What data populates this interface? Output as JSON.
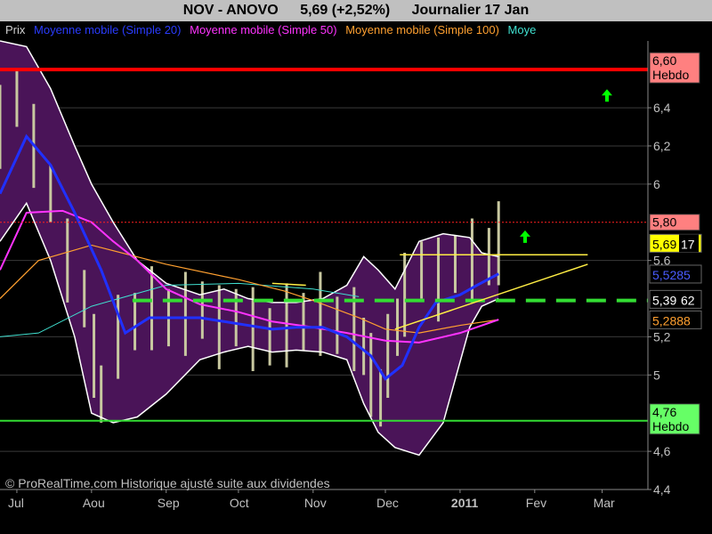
{
  "header": {
    "symbol": "NOV - ANOVO",
    "quote": "5,69 (+2,52%)",
    "period": "Journalier  17 Jan"
  },
  "legend": [
    {
      "label": "Prix",
      "color": "#d0d0d0"
    },
    {
      "label": "Moyenne mobile (Simple 20)",
      "color": "#2a3cff"
    },
    {
      "label": "Moyenne mobile (Simple 50)",
      "color": "#ff33ff"
    },
    {
      "label": "Moyenne mobile (Simple 100)",
      "color": "#ffa030"
    },
    {
      "label": "Moye",
      "color": "#40e0d0"
    }
  ],
  "credit": "© ProRealTime.com Historique ajusté suite aux dividendes",
  "colors": {
    "band_fill": "#4a1458",
    "band_edge": "#ffffff",
    "candles": "#c8c8a0",
    "ma20": "#2030ff",
    "ma50": "#ff33ff",
    "ma100": "#ffa030",
    "ma200": "#40e0d0",
    "resistance": "#ff0000",
    "support": "#33dd33",
    "dashed_level": "#33dd33",
    "trend": "#ffee44",
    "arrow": "#00ff00"
  },
  "chart_data": {
    "type": "line",
    "title": "NOV - ANOVO",
    "ylim": [
      4.4,
      6.75
    ],
    "y_ticks": [
      "6,4",
      "6,2",
      "6",
      "5,6",
      "5,2",
      "5",
      "4,6",
      "4,4"
    ],
    "y_tick_values": [
      6.4,
      6.2,
      6.0,
      5.6,
      5.2,
      5.0,
      4.6,
      4.4
    ],
    "x_ticks": [
      "Jul",
      "Aou",
      "Sep",
      "Oct",
      "Nov",
      "Dec",
      "2011",
      "Fev",
      "Mar"
    ],
    "x_tick_dates": [
      "2010-07-01",
      "2010-08-01",
      "2010-09-01",
      "2010-10-01",
      "2010-11-01",
      "2010-12-01",
      "2011-01-01",
      "2011-02-01",
      "2011-03-01"
    ],
    "x_range": [
      "2010-06-24",
      "2011-03-20"
    ],
    "last_date": "2011-01-17",
    "levels": [
      {
        "name": "resistance_hebdo",
        "label_value": "6,60",
        "label_text": "Hebdo",
        "value": 6.6,
        "color": "#ff0000",
        "badge_bg": "#ff8080",
        "style": "solid"
      },
      {
        "name": "level_580",
        "label_value": "5,80",
        "value": 5.8,
        "color": "#ff2020",
        "badge_bg": "#ff8080",
        "style": "dotted"
      },
      {
        "name": "support_dashed",
        "value": 5.39,
        "color": "#33dd33",
        "style": "dashed",
        "from": "2010-08-18"
      },
      {
        "name": "support_hebdo",
        "label_value": "4,76",
        "label_text": "Hebdo",
        "value": 4.76,
        "color": "#33dd33",
        "badge_bg": "#66ff66",
        "style": "solid"
      }
    ],
    "price_badges": [
      {
        "text": "5,69",
        "suffix": "17",
        "value": 5.69,
        "bg": "#ffff00",
        "fg": "#000"
      },
      {
        "text": "5,5285",
        "value": 5.5285,
        "bg": "#000",
        "fg": "#4a5cff"
      },
      {
        "text": "5,39",
        "suffix": "62",
        "value": 5.3962,
        "bg": "#000",
        "fg": "#fff"
      },
      {
        "text": "5,2888",
        "value": 5.2888,
        "bg": "#000",
        "fg": "#ffa030"
      }
    ],
    "trendlines": [
      {
        "x": [
          "2010-12-07",
          "2011-02-23"
        ],
        "y": [
          5.63,
          5.63
        ]
      },
      {
        "x": [
          "2010-12-05",
          "2011-02-23"
        ],
        "y": [
          5.24,
          5.58
        ]
      },
      {
        "x": [
          "2010-10-15",
          "2010-10-29"
        ],
        "y": [
          5.48,
          5.47
        ]
      }
    ],
    "arrows": [
      {
        "date": "2011-01-28",
        "value": 5.72
      },
      {
        "date": "2011-03-03",
        "value": 6.46
      }
    ],
    "series": [
      {
        "name": "Moyenne mobile (Simple 20)",
        "color": "#2030ff",
        "dates": [
          "2010-06-24",
          "2010-07-05",
          "2010-07-15",
          "2010-07-25",
          "2010-08-05",
          "2010-08-15",
          "2010-08-25",
          "2010-09-05",
          "2010-09-15",
          "2010-09-25",
          "2010-10-05",
          "2010-10-15",
          "2010-10-25",
          "2010-11-05",
          "2010-11-15",
          "2010-11-25",
          "2010-12-01",
          "2010-12-08",
          "2010-12-15",
          "2010-12-22",
          "2011-01-01",
          "2011-01-08",
          "2011-01-17"
        ],
        "values": [
          5.95,
          6.25,
          6.1,
          5.85,
          5.55,
          5.22,
          5.3,
          5.3,
          5.3,
          5.28,
          5.26,
          5.24,
          5.25,
          5.25,
          5.2,
          5.1,
          4.98,
          5.05,
          5.25,
          5.38,
          5.42,
          5.47,
          5.53
        ]
      },
      {
        "name": "Moyenne mobile (Simple 50)",
        "color": "#ff33ff",
        "dates": [
          "2010-06-24",
          "2010-07-05",
          "2010-07-20",
          "2010-08-01",
          "2010-08-10",
          "2010-08-20",
          "2010-09-01",
          "2010-09-15",
          "2010-10-01",
          "2010-10-15",
          "2010-11-01",
          "2010-11-15",
          "2010-12-01",
          "2010-12-15",
          "2011-01-01",
          "2011-01-17"
        ],
        "values": [
          5.55,
          5.85,
          5.86,
          5.8,
          5.7,
          5.6,
          5.45,
          5.37,
          5.33,
          5.28,
          5.25,
          5.22,
          5.18,
          5.17,
          5.22,
          5.29
        ]
      },
      {
        "name": "Moyenne mobile (Simple 100)",
        "color": "#ffa030",
        "dates": [
          "2010-06-24",
          "2010-07-10",
          "2010-08-01",
          "2010-09-01",
          "2010-10-01",
          "2010-10-20",
          "2010-11-01",
          "2010-11-20",
          "2010-12-01",
          "2010-12-15",
          "2011-01-01",
          "2011-01-17"
        ],
        "values": [
          5.4,
          5.6,
          5.68,
          5.58,
          5.5,
          5.44,
          5.39,
          5.3,
          5.24,
          5.22,
          5.26,
          5.29
        ]
      },
      {
        "name": "Moye",
        "color": "#40e0d0",
        "dates": [
          "2010-06-24",
          "2010-07-10",
          "2010-08-01",
          "2010-09-01",
          "2010-10-01",
          "2010-11-01",
          "2010-11-20"
        ],
        "values": [
          5.2,
          5.22,
          5.36,
          5.47,
          5.48,
          5.45,
          5.41
        ]
      },
      {
        "name": "band_upper",
        "color": "#ffffff",
        "dates": [
          "2010-06-24",
          "2010-07-05",
          "2010-07-15",
          "2010-07-25",
          "2010-08-01",
          "2010-08-10",
          "2010-08-20",
          "2010-09-01",
          "2010-09-15",
          "2010-09-25",
          "2010-10-05",
          "2010-10-15",
          "2010-10-25",
          "2010-11-05",
          "2010-11-15",
          "2010-11-22",
          "2010-11-28",
          "2010-12-05",
          "2010-12-15",
          "2010-12-25",
          "2011-01-05",
          "2011-01-10",
          "2011-01-17"
        ],
        "values": [
          6.75,
          6.72,
          6.5,
          6.2,
          6.0,
          5.8,
          5.6,
          5.48,
          5.42,
          5.45,
          5.4,
          5.38,
          5.38,
          5.4,
          5.47,
          5.62,
          5.55,
          5.45,
          5.7,
          5.74,
          5.72,
          5.64,
          5.62
        ]
      },
      {
        "name": "band_lower",
        "color": "#ffffff",
        "dates": [
          "2010-06-24",
          "2010-07-05",
          "2010-07-15",
          "2010-07-25",
          "2010-08-01",
          "2010-08-10",
          "2010-08-20",
          "2010-09-01",
          "2010-09-15",
          "2010-09-25",
          "2010-10-05",
          "2010-10-15",
          "2010-10-25",
          "2010-11-05",
          "2010-11-15",
          "2010-11-22",
          "2010-11-28",
          "2010-12-05",
          "2010-12-15",
          "2010-12-25",
          "2011-01-05",
          "2011-01-10",
          "2011-01-17"
        ],
        "values": [
          5.7,
          5.9,
          5.6,
          5.2,
          4.8,
          4.75,
          4.78,
          4.9,
          5.08,
          5.12,
          5.15,
          5.12,
          5.13,
          5.12,
          5.08,
          4.85,
          4.7,
          4.62,
          4.58,
          4.75,
          5.25,
          5.36,
          5.4
        ]
      },
      {
        "name": "Prix",
        "color": "#c8c8a0",
        "dates": [
          "2010-06-24",
          "2010-07-01",
          "2010-07-08",
          "2010-07-15",
          "2010-07-22",
          "2010-07-29",
          "2010-08-02",
          "2010-08-05",
          "2010-08-12",
          "2010-08-19",
          "2010-08-26",
          "2010-09-02",
          "2010-09-09",
          "2010-09-16",
          "2010-09-23",
          "2010-09-30",
          "2010-10-07",
          "2010-10-14",
          "2010-10-21",
          "2010-10-28",
          "2010-11-04",
          "2010-11-11",
          "2010-11-18",
          "2010-11-22",
          "2010-11-25",
          "2010-11-29",
          "2010-12-02",
          "2010-12-06",
          "2010-12-09",
          "2010-12-16",
          "2010-12-23",
          "2010-12-30",
          "2011-01-06",
          "2011-01-13",
          "2011-01-17"
        ],
        "values": [
          6.3,
          6.45,
          6.2,
          5.95,
          5.6,
          5.4,
          5.1,
          4.9,
          5.2,
          5.28,
          5.35,
          5.3,
          5.32,
          5.34,
          5.25,
          5.3,
          5.24,
          5.2,
          5.26,
          5.28,
          5.32,
          5.26,
          5.24,
          5.15,
          5.0,
          4.88,
          5.1,
          5.25,
          5.42,
          5.55,
          5.5,
          5.58,
          5.6,
          5.62,
          5.69
        ]
      }
    ]
  }
}
